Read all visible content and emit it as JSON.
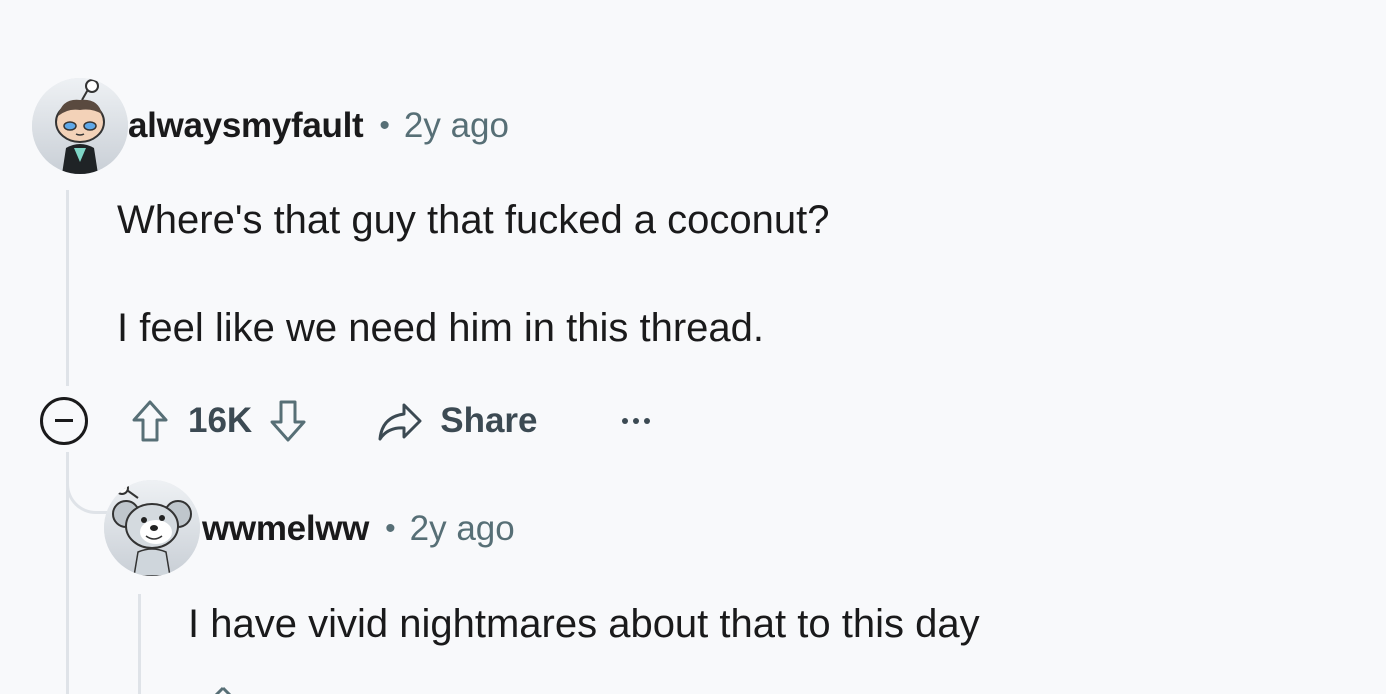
{
  "comment": {
    "username": "alwaysmyfault",
    "separator": "•",
    "timestamp": "2y ago",
    "body_line1": "Where's that guy that fucked a coconut?",
    "body_line2": "I feel like we need him in this thread.",
    "actions": {
      "collapse_icon": "minus-circle-icon",
      "upvote_icon": "arrow-up-icon",
      "vote_count": "16K",
      "downvote_icon": "arrow-down-icon",
      "share_icon": "share-arrow-icon",
      "share_label": "Share",
      "more_icon": "ellipsis-icon"
    }
  },
  "reply": {
    "username": "wwmelww",
    "separator": "•",
    "timestamp": "2y ago",
    "body": "I have vivid nightmares about that to this day"
  },
  "colors": {
    "background": "#f8f9fb",
    "text": "#1a1a1b",
    "muted": "#576f76",
    "action": "#3c4a53",
    "thread_line": "#dfe3e8"
  }
}
